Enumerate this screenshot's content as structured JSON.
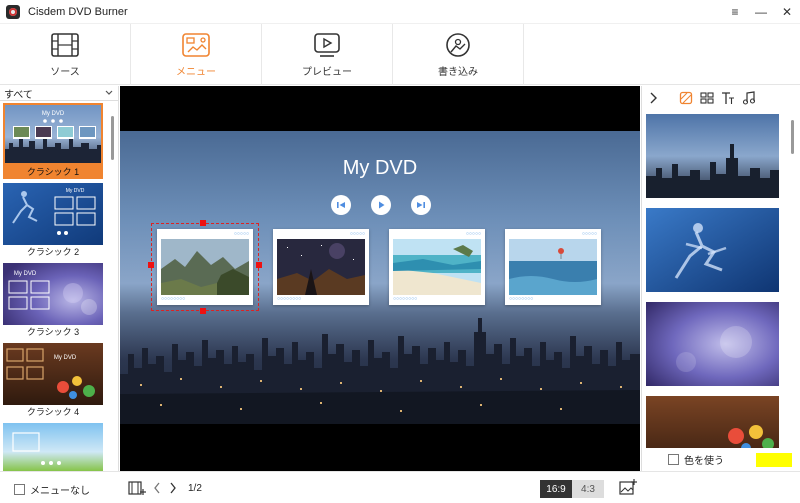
{
  "window": {
    "title": "Cisdem DVD Burner",
    "controls": [
      "≡",
      "—",
      "✕"
    ]
  },
  "tabs": [
    {
      "label": "ソース",
      "icon": "film-icon",
      "active": false
    },
    {
      "label": "メニュー",
      "icon": "menu-template-icon",
      "active": true
    },
    {
      "label": "プレビュー",
      "icon": "play-preview-icon",
      "active": false
    },
    {
      "label": "書き込み",
      "icon": "burn-disc-icon",
      "active": false
    }
  ],
  "left_panel": {
    "filter": "すべて",
    "templates": [
      {
        "label": "クラシック 1",
        "selected": true
      },
      {
        "label": "クラシック 2",
        "selected": false
      },
      {
        "label": "クラシック 3",
        "selected": false
      },
      {
        "label": "クラシック 4",
        "selected": false
      },
      {
        "label": "",
        "selected": false
      }
    ]
  },
  "preview": {
    "dvd_title": "My DVD",
    "cards": 4
  },
  "right_panel": {
    "tools": [
      "collapse-arrow-icon",
      "background-icon",
      "layout-icon",
      "text-icon",
      "music-icon"
    ],
    "active_tool": "background-icon",
    "use_color_label": "色を使う",
    "color": "#ffff00"
  },
  "bottom": {
    "no_menu_label": "メニューなし",
    "page": "1/2",
    "ratio_16_9": "16:9",
    "ratio_4_3": "4:3"
  },
  "colors": {
    "accent": "#f08430"
  }
}
